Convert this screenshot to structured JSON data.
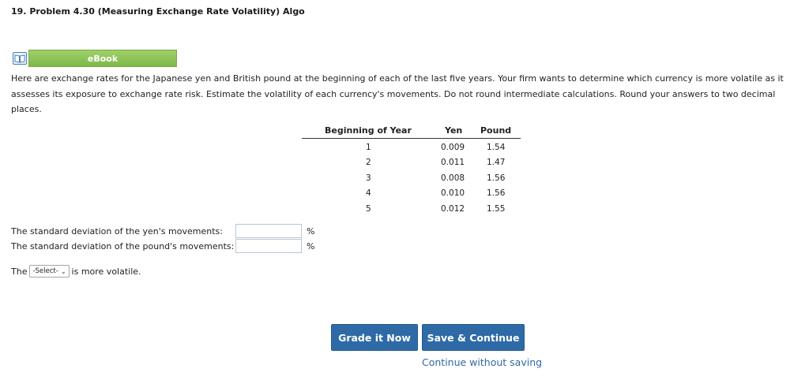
{
  "problem": {
    "title": "19. Problem 4.30 (Measuring Exchange Rate Volatility) Algo"
  },
  "ebook": {
    "label": "eBook",
    "icon": "book-icon"
  },
  "instructions": "Here are exchange rates for the Japanese yen and British pound at the beginning of each of the last five years. Your firm wants to determine which currency is more volatile as it assesses its exposure to exchange rate risk. Estimate the volatility of each currency's movements. Do not round intermediate calculations. Round your answers to two decimal places.",
  "table": {
    "headers": [
      "Beginning of Year",
      "Yen",
      "Pound"
    ],
    "rows": [
      {
        "year": "1",
        "yen": "0.009",
        "pound": "1.54"
      },
      {
        "year": "2",
        "yen": "0.011",
        "pound": "1.47"
      },
      {
        "year": "3",
        "yen": "0.008",
        "pound": "1.56"
      },
      {
        "year": "4",
        "yen": "0.010",
        "pound": "1.56"
      },
      {
        "year": "5",
        "yen": "0.012",
        "pound": "1.55"
      }
    ]
  },
  "questions": {
    "yen_label": "The standard deviation of the yen's movements:",
    "yen_value": "",
    "pound_label": "The standard deviation of the pound's movements:",
    "pound_value": "",
    "percent_symbol": "%",
    "volatile_prefix": "The",
    "volatile_suffix": "is more volatile.",
    "select_value": "-Select-"
  },
  "actions": {
    "grade_label": "Grade it Now",
    "save_label": "Save & Continue",
    "continue_label": "Continue without saving"
  }
}
